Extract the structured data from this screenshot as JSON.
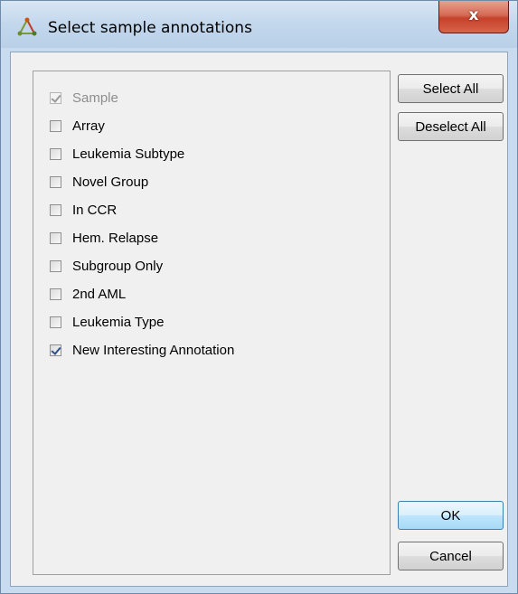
{
  "window": {
    "title": "Select sample annotations",
    "close_label": "x"
  },
  "annotations": [
    {
      "label": "Sample",
      "checked": true,
      "disabled": true
    },
    {
      "label": "Array",
      "checked": false,
      "disabled": false
    },
    {
      "label": "Leukemia Subtype",
      "checked": false,
      "disabled": false
    },
    {
      "label": "Novel Group",
      "checked": false,
      "disabled": false
    },
    {
      "label": "In CCR",
      "checked": false,
      "disabled": false
    },
    {
      "label": "Hem. Relapse",
      "checked": false,
      "disabled": false
    },
    {
      "label": "Subgroup Only",
      "checked": false,
      "disabled": false
    },
    {
      "label": "2nd AML",
      "checked": false,
      "disabled": false
    },
    {
      "label": "Leukemia Type",
      "checked": false,
      "disabled": false
    },
    {
      "label": "New Interesting Annotation",
      "checked": true,
      "disabled": false
    }
  ],
  "buttons": {
    "select_all": "Select All",
    "deselect_all": "Deselect All",
    "ok": "OK",
    "cancel": "Cancel"
  },
  "colors": {
    "titlebar": "#c3d7ec",
    "close_button": "#c6412a",
    "dialog_background": "#f0f0f0",
    "default_button": "#bee6fd"
  }
}
